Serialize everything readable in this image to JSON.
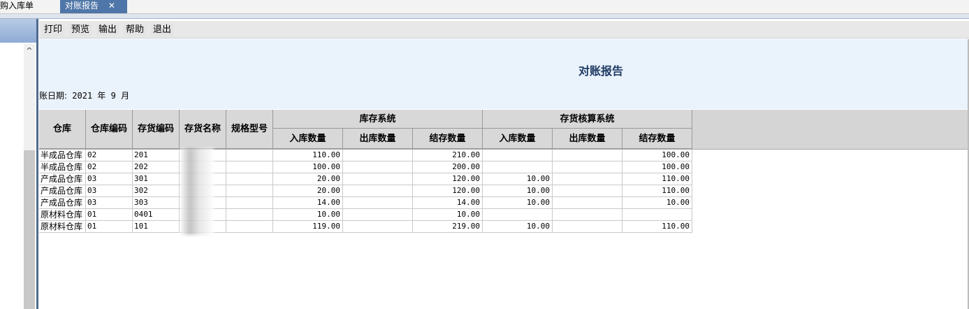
{
  "tabs": [
    {
      "label": "购入库单",
      "active": false
    },
    {
      "label": "对账报告",
      "active": true,
      "close": "✕"
    }
  ],
  "toolbar": {
    "buttons": [
      "打印",
      "预览",
      "输出",
      "帮助",
      "退出"
    ]
  },
  "report": {
    "title": "对账报告",
    "period_prefix": "账日期:",
    "year": "2021",
    "year_unit": "年",
    "month": "9",
    "month_unit": "月"
  },
  "table": {
    "headers": {
      "warehouse": "仓库",
      "warehouse_code": "仓库编码",
      "item_code": "存货编码",
      "item_name": "存货名称",
      "spec": "规格型号",
      "group_inventory": "库存系统",
      "group_accounting": "存货核算系统",
      "in_qty": "入库数量",
      "out_qty": "出库数量",
      "balance_qty": "结存数量"
    },
    "rows": [
      {
        "warehouse": "半成品仓库",
        "wcode": "02",
        "icode": "201",
        "inv_in": "110.00",
        "inv_out": "",
        "inv_bal": "210.00",
        "acc_in": "",
        "acc_out": "",
        "acc_bal": "100.00"
      },
      {
        "warehouse": "半成品仓库",
        "wcode": "02",
        "icode": "202",
        "inv_in": "100.00",
        "inv_out": "",
        "inv_bal": "200.00",
        "acc_in": "",
        "acc_out": "",
        "acc_bal": "100.00"
      },
      {
        "warehouse": "产成品仓库",
        "wcode": "03",
        "icode": "301",
        "inv_in": "20.00",
        "inv_out": "",
        "inv_bal": "120.00",
        "acc_in": "10.00",
        "acc_out": "",
        "acc_bal": "110.00"
      },
      {
        "warehouse": "产成品仓库",
        "wcode": "03",
        "icode": "302",
        "inv_in": "20.00",
        "inv_out": "",
        "inv_bal": "120.00",
        "acc_in": "10.00",
        "acc_out": "",
        "acc_bal": "110.00"
      },
      {
        "warehouse": "产成品仓库",
        "wcode": "03",
        "icode": "303",
        "inv_in": "14.00",
        "inv_out": "",
        "inv_bal": "14.00",
        "acc_in": "10.00",
        "acc_out": "",
        "acc_bal": "10.00"
      },
      {
        "warehouse": "原材料仓库",
        "wcode": "01",
        "icode": "0401",
        "inv_in": "10.00",
        "inv_out": "",
        "inv_bal": "10.00",
        "acc_in": "",
        "acc_out": "",
        "acc_bal": ""
      },
      {
        "warehouse": "原材料仓库",
        "wcode": "01",
        "icode": "101",
        "inv_in": "119.00",
        "inv_out": "",
        "inv_bal": "219.00",
        "acc_in": "10.00",
        "acc_out": "",
        "acc_bal": "110.00"
      }
    ]
  },
  "left_panel": {
    "scroll_up_icon": "chevron-up-icon"
  }
}
